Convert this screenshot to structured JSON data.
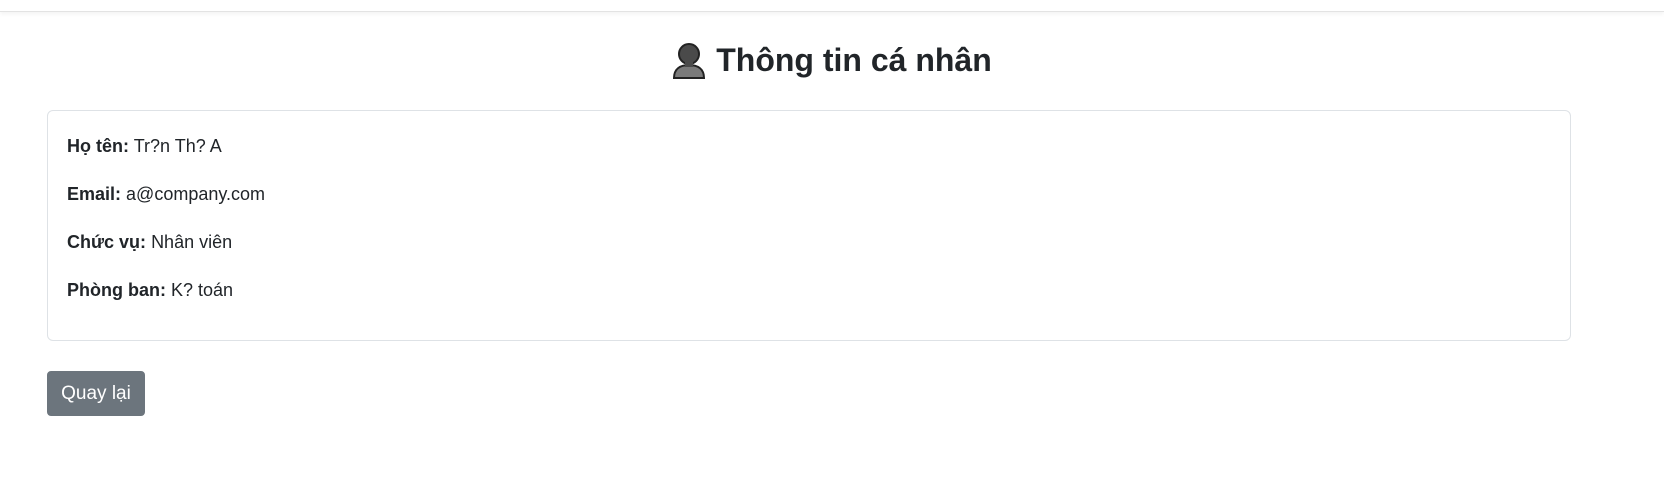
{
  "header": {
    "title": "Thông tin cá nhân",
    "icon": "user-silhouette-icon"
  },
  "profile": {
    "name_label": "Họ tên:",
    "name_value": "Tr?n Th? A",
    "email_label": "Email:",
    "email_value": "a@company.com",
    "position_label": "Chức vụ:",
    "position_value": "Nhân viên",
    "department_label": "Phòng ban:",
    "department_value": "K? toán"
  },
  "actions": {
    "back_label": "Quay lại"
  },
  "colors": {
    "button_secondary": "#6c757d",
    "card_border": "#dee2e6",
    "text": "#212529"
  }
}
